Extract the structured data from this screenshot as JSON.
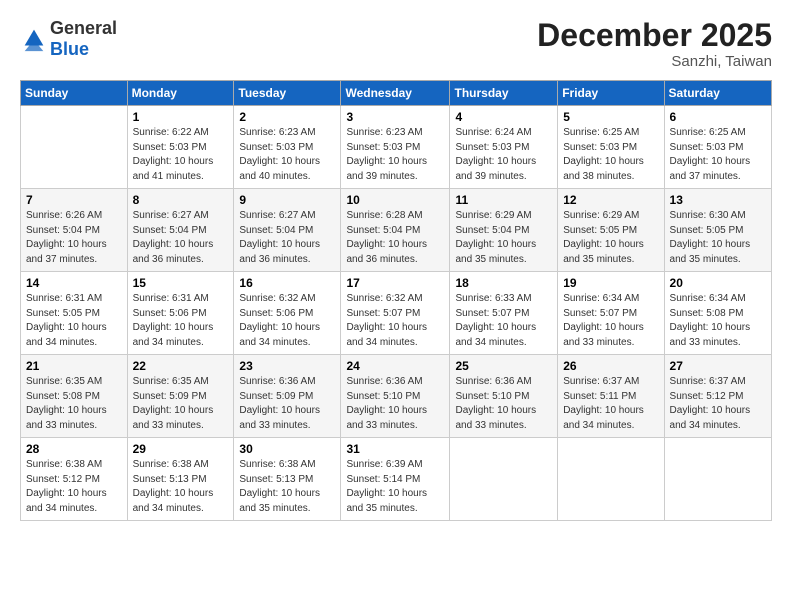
{
  "logo": {
    "general": "General",
    "blue": "Blue"
  },
  "title": "December 2025",
  "location": "Sanzhi, Taiwan",
  "days_header": [
    "Sunday",
    "Monday",
    "Tuesday",
    "Wednesday",
    "Thursday",
    "Friday",
    "Saturday"
  ],
  "weeks": [
    [
      {
        "day": "",
        "sunrise": "",
        "sunset": "",
        "daylight": ""
      },
      {
        "day": "1",
        "sunrise": "Sunrise: 6:22 AM",
        "sunset": "Sunset: 5:03 PM",
        "daylight": "Daylight: 10 hours and 41 minutes."
      },
      {
        "day": "2",
        "sunrise": "Sunrise: 6:23 AM",
        "sunset": "Sunset: 5:03 PM",
        "daylight": "Daylight: 10 hours and 40 minutes."
      },
      {
        "day": "3",
        "sunrise": "Sunrise: 6:23 AM",
        "sunset": "Sunset: 5:03 PM",
        "daylight": "Daylight: 10 hours and 39 minutes."
      },
      {
        "day": "4",
        "sunrise": "Sunrise: 6:24 AM",
        "sunset": "Sunset: 5:03 PM",
        "daylight": "Daylight: 10 hours and 39 minutes."
      },
      {
        "day": "5",
        "sunrise": "Sunrise: 6:25 AM",
        "sunset": "Sunset: 5:03 PM",
        "daylight": "Daylight: 10 hours and 38 minutes."
      },
      {
        "day": "6",
        "sunrise": "Sunrise: 6:25 AM",
        "sunset": "Sunset: 5:03 PM",
        "daylight": "Daylight: 10 hours and 37 minutes."
      }
    ],
    [
      {
        "day": "7",
        "sunrise": "Sunrise: 6:26 AM",
        "sunset": "Sunset: 5:04 PM",
        "daylight": "Daylight: 10 hours and 37 minutes."
      },
      {
        "day": "8",
        "sunrise": "Sunrise: 6:27 AM",
        "sunset": "Sunset: 5:04 PM",
        "daylight": "Daylight: 10 hours and 36 minutes."
      },
      {
        "day": "9",
        "sunrise": "Sunrise: 6:27 AM",
        "sunset": "Sunset: 5:04 PM",
        "daylight": "Daylight: 10 hours and 36 minutes."
      },
      {
        "day": "10",
        "sunrise": "Sunrise: 6:28 AM",
        "sunset": "Sunset: 5:04 PM",
        "daylight": "Daylight: 10 hours and 36 minutes."
      },
      {
        "day": "11",
        "sunrise": "Sunrise: 6:29 AM",
        "sunset": "Sunset: 5:04 PM",
        "daylight": "Daylight: 10 hours and 35 minutes."
      },
      {
        "day": "12",
        "sunrise": "Sunrise: 6:29 AM",
        "sunset": "Sunset: 5:05 PM",
        "daylight": "Daylight: 10 hours and 35 minutes."
      },
      {
        "day": "13",
        "sunrise": "Sunrise: 6:30 AM",
        "sunset": "Sunset: 5:05 PM",
        "daylight": "Daylight: 10 hours and 35 minutes."
      }
    ],
    [
      {
        "day": "14",
        "sunrise": "Sunrise: 6:31 AM",
        "sunset": "Sunset: 5:05 PM",
        "daylight": "Daylight: 10 hours and 34 minutes."
      },
      {
        "day": "15",
        "sunrise": "Sunrise: 6:31 AM",
        "sunset": "Sunset: 5:06 PM",
        "daylight": "Daylight: 10 hours and 34 minutes."
      },
      {
        "day": "16",
        "sunrise": "Sunrise: 6:32 AM",
        "sunset": "Sunset: 5:06 PM",
        "daylight": "Daylight: 10 hours and 34 minutes."
      },
      {
        "day": "17",
        "sunrise": "Sunrise: 6:32 AM",
        "sunset": "Sunset: 5:07 PM",
        "daylight": "Daylight: 10 hours and 34 minutes."
      },
      {
        "day": "18",
        "sunrise": "Sunrise: 6:33 AM",
        "sunset": "Sunset: 5:07 PM",
        "daylight": "Daylight: 10 hours and 34 minutes."
      },
      {
        "day": "19",
        "sunrise": "Sunrise: 6:34 AM",
        "sunset": "Sunset: 5:07 PM",
        "daylight": "Daylight: 10 hours and 33 minutes."
      },
      {
        "day": "20",
        "sunrise": "Sunrise: 6:34 AM",
        "sunset": "Sunset: 5:08 PM",
        "daylight": "Daylight: 10 hours and 33 minutes."
      }
    ],
    [
      {
        "day": "21",
        "sunrise": "Sunrise: 6:35 AM",
        "sunset": "Sunset: 5:08 PM",
        "daylight": "Daylight: 10 hours and 33 minutes."
      },
      {
        "day": "22",
        "sunrise": "Sunrise: 6:35 AM",
        "sunset": "Sunset: 5:09 PM",
        "daylight": "Daylight: 10 hours and 33 minutes."
      },
      {
        "day": "23",
        "sunrise": "Sunrise: 6:36 AM",
        "sunset": "Sunset: 5:09 PM",
        "daylight": "Daylight: 10 hours and 33 minutes."
      },
      {
        "day": "24",
        "sunrise": "Sunrise: 6:36 AM",
        "sunset": "Sunset: 5:10 PM",
        "daylight": "Daylight: 10 hours and 33 minutes."
      },
      {
        "day": "25",
        "sunrise": "Sunrise: 6:36 AM",
        "sunset": "Sunset: 5:10 PM",
        "daylight": "Daylight: 10 hours and 33 minutes."
      },
      {
        "day": "26",
        "sunrise": "Sunrise: 6:37 AM",
        "sunset": "Sunset: 5:11 PM",
        "daylight": "Daylight: 10 hours and 34 minutes."
      },
      {
        "day": "27",
        "sunrise": "Sunrise: 6:37 AM",
        "sunset": "Sunset: 5:12 PM",
        "daylight": "Daylight: 10 hours and 34 minutes."
      }
    ],
    [
      {
        "day": "28",
        "sunrise": "Sunrise: 6:38 AM",
        "sunset": "Sunset: 5:12 PM",
        "daylight": "Daylight: 10 hours and 34 minutes."
      },
      {
        "day": "29",
        "sunrise": "Sunrise: 6:38 AM",
        "sunset": "Sunset: 5:13 PM",
        "daylight": "Daylight: 10 hours and 34 minutes."
      },
      {
        "day": "30",
        "sunrise": "Sunrise: 6:38 AM",
        "sunset": "Sunset: 5:13 PM",
        "daylight": "Daylight: 10 hours and 35 minutes."
      },
      {
        "day": "31",
        "sunrise": "Sunrise: 6:39 AM",
        "sunset": "Sunset: 5:14 PM",
        "daylight": "Daylight: 10 hours and 35 minutes."
      },
      {
        "day": "",
        "sunrise": "",
        "sunset": "",
        "daylight": ""
      },
      {
        "day": "",
        "sunrise": "",
        "sunset": "",
        "daylight": ""
      },
      {
        "day": "",
        "sunrise": "",
        "sunset": "",
        "daylight": ""
      }
    ]
  ]
}
